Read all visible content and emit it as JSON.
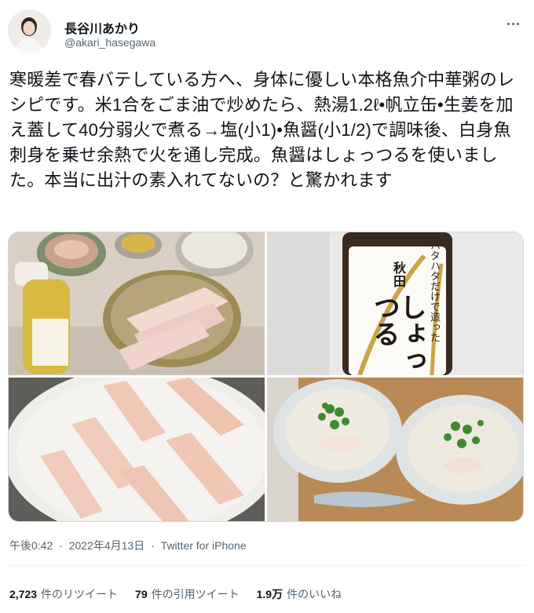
{
  "author": {
    "display_name": "長谷川あかり",
    "handle": "@akari_hasegawa",
    "avatar_icon": "profile-photo"
  },
  "tweet": {
    "text": "寒暖差で春バテしている方へ、身体に優しい本格魚介中華粥のレシピです。米1合をごま油で炒めたら、熱湯1.2ℓ•帆立缶•生姜を加え蓋して40分弱火で煮る→塩(小1)•魚醤(小1/2)で調味後、白身魚刺身を乗せ余熱で火を通し完成。魚醤はしょっつるを使いました。本当に出汁の素入れてないの？と驚かれます"
  },
  "photos": {
    "bottle_label_vertical": "ハタハタだけで造った",
    "bottle_label_brand": "しょっつる",
    "bottle_label_region": "秋田"
  },
  "meta": {
    "time": "午後0:42",
    "separator1": "·",
    "date": "2022年4月13日",
    "separator2": "·",
    "source": "Twitter for iPhone"
  },
  "stats": {
    "retweets_count": "2,723",
    "retweets_label": "件のリツイート",
    "quotes_count": "79",
    "quotes_label": "件の引用ツイート",
    "likes_count": "1.9万",
    "likes_label": "件のいいね"
  },
  "colors": {
    "text_primary": "#0f1419",
    "text_secondary": "#536471",
    "divider": "#eff3f4"
  }
}
